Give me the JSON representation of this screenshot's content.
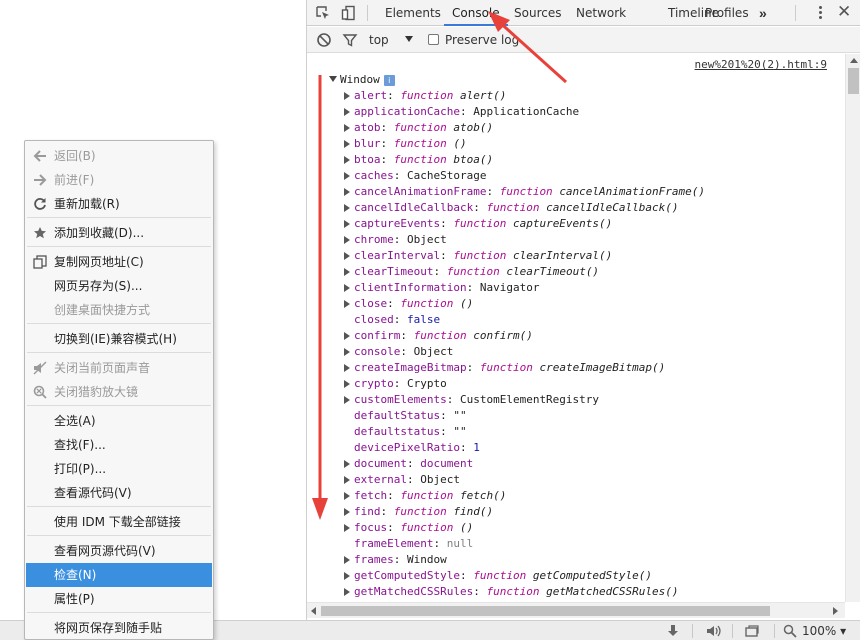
{
  "devtools": {
    "tabs": [
      "Elements",
      "Console",
      "Sources",
      "Network",
      "Timeline",
      "Profiles"
    ],
    "active_tab": "Console",
    "more_tabs": "»",
    "console": {
      "context": "top",
      "preserve_log_label": "Preserve log",
      "preserve_log_checked": false,
      "source_link": "new%201%20(2).html:9",
      "root_label": "Window",
      "info_badge": "i",
      "properties": [
        {
          "key": "alert",
          "kind": "fn",
          "value": "alert()"
        },
        {
          "key": "applicationCache",
          "kind": "obj",
          "value": "ApplicationCache"
        },
        {
          "key": "atob",
          "kind": "fn",
          "value": "atob()"
        },
        {
          "key": "blur",
          "kind": "fn",
          "value": "()"
        },
        {
          "key": "btoa",
          "kind": "fn",
          "value": "btoa()"
        },
        {
          "key": "caches",
          "kind": "obj",
          "value": "CacheStorage"
        },
        {
          "key": "cancelAnimationFrame",
          "kind": "fn",
          "value": "cancelAnimationFrame()"
        },
        {
          "key": "cancelIdleCallback",
          "kind": "fn",
          "value": "cancelIdleCallback()"
        },
        {
          "key": "captureEvents",
          "kind": "fn",
          "value": "captureEvents()"
        },
        {
          "key": "chrome",
          "kind": "obj",
          "value": "Object"
        },
        {
          "key": "clearInterval",
          "kind": "fn",
          "value": "clearInterval()"
        },
        {
          "key": "clearTimeout",
          "kind": "fn",
          "value": "clearTimeout()"
        },
        {
          "key": "clientInformation",
          "kind": "obj",
          "value": "Navigator"
        },
        {
          "key": "close",
          "kind": "fn",
          "value": "()"
        },
        {
          "key": "closed",
          "kind": "bool",
          "value": "false"
        },
        {
          "key": "confirm",
          "kind": "fn",
          "value": "confirm()"
        },
        {
          "key": "console",
          "kind": "obj",
          "value": "Object"
        },
        {
          "key": "createImageBitmap",
          "kind": "fn",
          "value": "createImageBitmap()"
        },
        {
          "key": "crypto",
          "kind": "obj",
          "value": "Crypto"
        },
        {
          "key": "customElements",
          "kind": "obj",
          "value": "CustomElementRegistry"
        },
        {
          "key": "defaultStatus",
          "kind": "str",
          "value": "\"\""
        },
        {
          "key": "defaultstatus",
          "kind": "str",
          "value": "\"\""
        },
        {
          "key": "devicePixelRatio",
          "kind": "num",
          "value": "1"
        },
        {
          "key": "document",
          "kind": "doc",
          "value": "document"
        },
        {
          "key": "external",
          "kind": "obj",
          "value": "Object"
        },
        {
          "key": "fetch",
          "kind": "fn",
          "value": "fetch()"
        },
        {
          "key": "find",
          "kind": "fn",
          "value": "find()"
        },
        {
          "key": "focus",
          "kind": "fn",
          "value": "()"
        },
        {
          "key": "frameElement",
          "kind": "null",
          "value": "null"
        },
        {
          "key": "frames",
          "kind": "obj",
          "value": "Window"
        },
        {
          "key": "getComputedStyle",
          "kind": "fn",
          "value": "getComputedStyle()"
        },
        {
          "key": "getMatchedCSSRules",
          "kind": "fn",
          "value": "getMatchedCSSRules()"
        }
      ],
      "function_keyword": "function"
    }
  },
  "context_menu": {
    "items": [
      {
        "label": "返回(B)",
        "icon": "arrow-left-icon",
        "disabled": true
      },
      {
        "label": "前进(F)",
        "icon": "arrow-right-icon",
        "disabled": true
      },
      {
        "label": "重新加载(R)",
        "icon": "reload-icon",
        "disabled": false
      },
      {
        "label": "添加到收藏(D)...",
        "icon": "star-icon",
        "disabled": false
      },
      {
        "label": "复制网页地址(C)",
        "icon": "copy-icon",
        "disabled": false
      },
      {
        "label": "网页另存为(S)...",
        "icon": "",
        "disabled": false
      },
      {
        "label": "创建桌面快捷方式",
        "icon": "",
        "disabled": true
      },
      {
        "label": "切换到(IE)兼容模式(H)",
        "icon": "",
        "disabled": false
      },
      {
        "label": "关闭当前页面声音",
        "icon": "mute-icon",
        "disabled": true
      },
      {
        "label": "关闭猎豹放大镜",
        "icon": "magnifier-icon",
        "disabled": true
      },
      {
        "label": "全选(A)",
        "icon": "",
        "disabled": false
      },
      {
        "label": "查找(F)...",
        "icon": "",
        "disabled": false
      },
      {
        "label": "打印(P)...",
        "icon": "",
        "disabled": false
      },
      {
        "label": "查看源代码(V)",
        "icon": "",
        "disabled": false
      },
      {
        "label": "使用 IDM 下载全部链接",
        "icon": "",
        "disabled": false
      },
      {
        "label": "查看网页源代码(V)",
        "icon": "",
        "disabled": false
      },
      {
        "label": "检查(N)",
        "icon": "",
        "disabled": false,
        "selected": true
      },
      {
        "label": "属性(P)",
        "icon": "",
        "disabled": false
      },
      {
        "label": "将网页保存到随手贴",
        "icon": "",
        "disabled": false
      }
    ]
  },
  "statusbar": {
    "zoom": "100%"
  },
  "colors": {
    "accent": "#3b8fdf",
    "annotation_arrow": "#e8413a",
    "key_purple": "#881391",
    "function_keyword": "#aa0d91"
  }
}
